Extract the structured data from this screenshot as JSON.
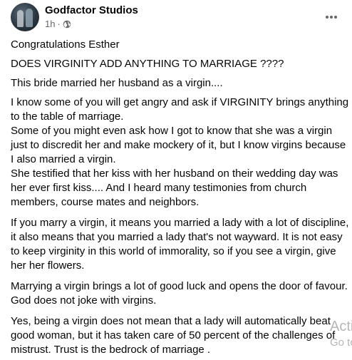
{
  "post": {
    "author": "Godfactor Studios",
    "time": "1h",
    "separator": "·",
    "privacy_icon": "globe-icon",
    "more_icon": "more-horizontal-icon"
  },
  "content": {
    "p1": "Congratulations Esther",
    "p2": "DOES VIRGINITY ADD ANYTHING TO MARRIAGE ????",
    "p3": "This bride married her husband as a virgin....",
    "p4": "I know some of you will get angry and ask if VIRGINITY brings anything to the table of marriage.\nSome of you might even ask how I got to know that she was a virgin just to discredit her and make mockery of it, but I know virgins because I also married a virgin.\nShe testified that her kiss with her husband on their wedding day was her ever first kiss.... And I heard many testimonies from church members, course mates and neighbors.",
    "p5": "If you marry a virgin, it means you married a lady with a lot of discipline, it also means that you married a lady that's not wayward. It is not easy to keep virginity in this world of immorality, so if you see a virgin, give her her flowers.",
    "p6": "Marrying a virgin brings a lot of good luck and opens the door of favour. God does not joke with virgins.",
    "p7": "Yes, being a virgin does not mean that a lady will automatically beat good woman, but it has taken care of 50 percent of the challenges of mistrust. Trust is the bedrock of marriage ."
  },
  "overlay": {
    "activate_text": "Acti",
    "goto_text": "Go to"
  },
  "colors": {
    "text": "#050505",
    "secondary": "#65676b",
    "watermark": "#b6b6b6"
  }
}
